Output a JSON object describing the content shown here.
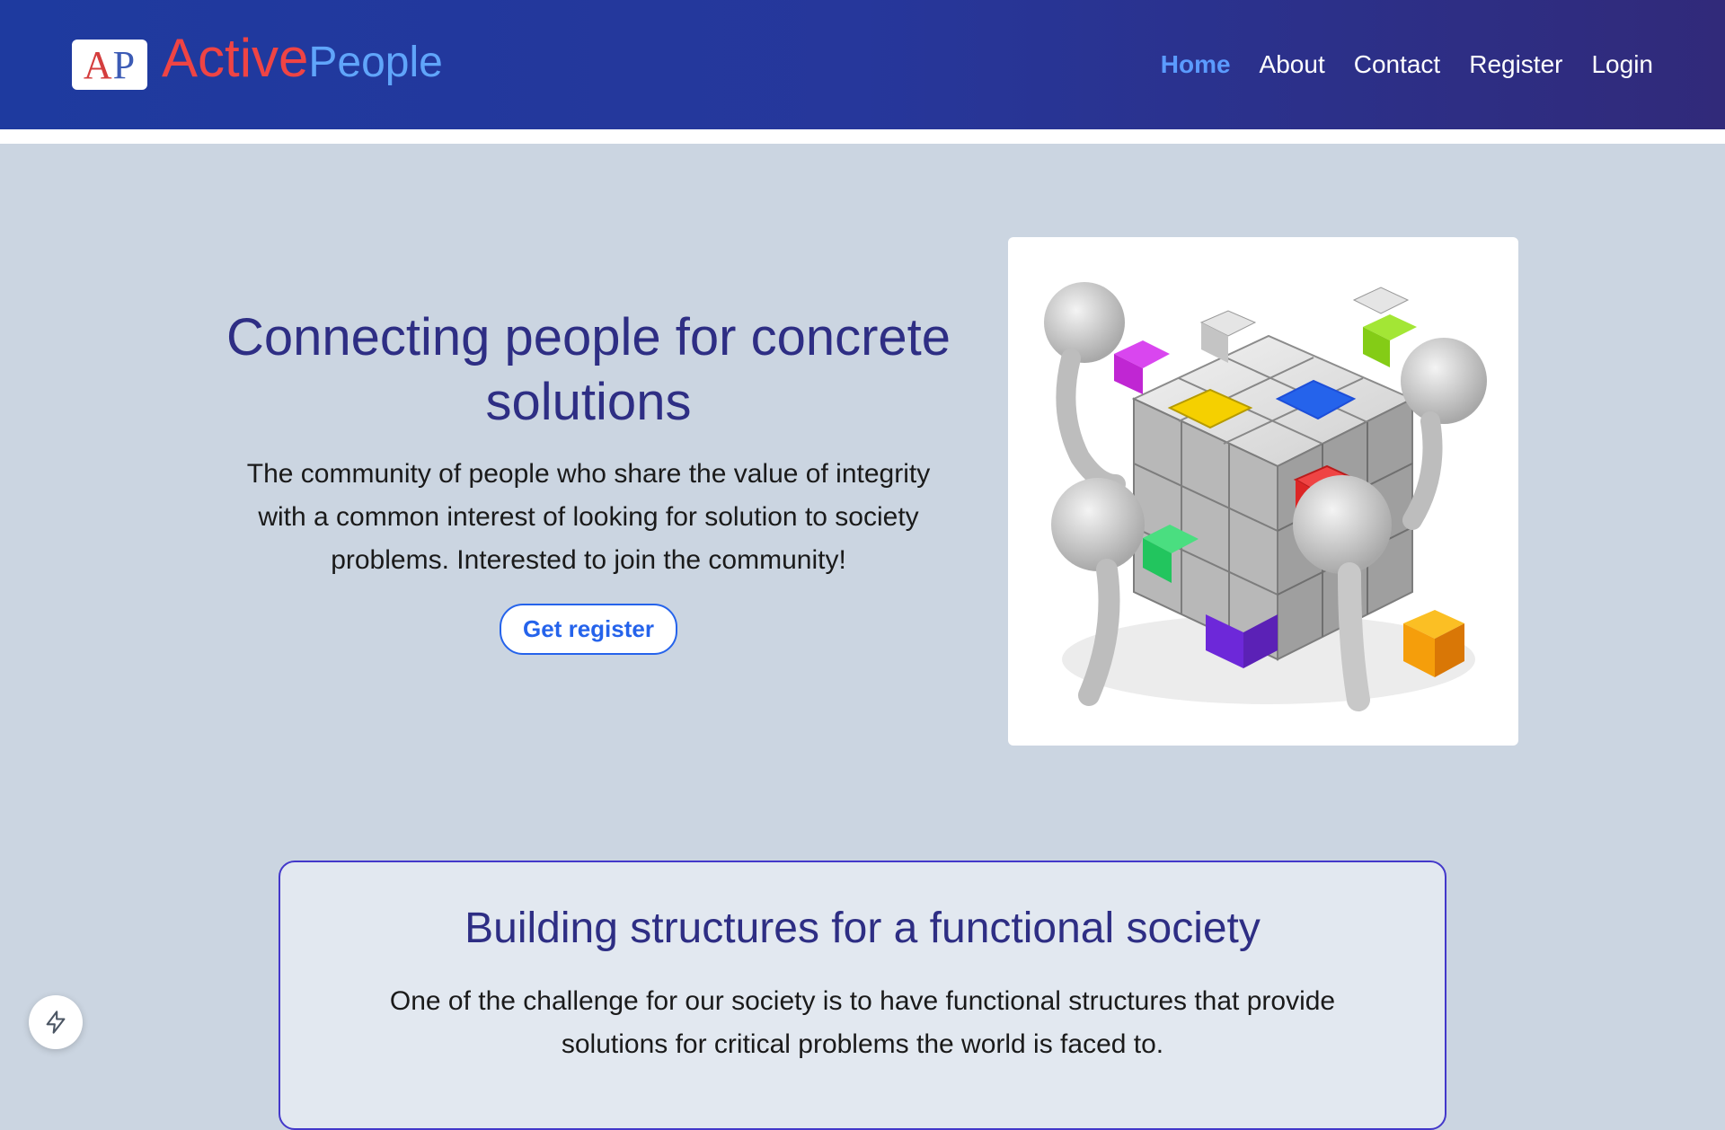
{
  "header": {
    "logo_text_a": "A",
    "logo_text_p": "P",
    "brand_active": "Active",
    "brand_people": "People",
    "nav": [
      {
        "label": "Home",
        "active": true
      },
      {
        "label": "About"
      },
      {
        "label": "Contact"
      },
      {
        "label": "Register"
      },
      {
        "label": "Login"
      }
    ]
  },
  "hero": {
    "title": "Connecting people for concrete solutions",
    "description": "The community of people who share the value of integrity with a common interest of looking for solution to society problems. Interested to join the community!",
    "cta_label": "Get register",
    "image_icon": "team-building-cube-illustration"
  },
  "card": {
    "title": "Building structures for a functional society",
    "text": "One of the challenge for our society is to have functional structures that provide solutions for critical problems the world is faced to."
  },
  "fab": {
    "icon": "lightning-icon"
  },
  "colors": {
    "header_start": "#1e3a9f",
    "header_end": "#312a7a",
    "page_bg": "#cbd5e1",
    "accent_blue": "#2563eb",
    "brand_red": "#ef4444",
    "brand_light_blue": "#60a5fa",
    "heading_indigo": "#2e2e84"
  }
}
